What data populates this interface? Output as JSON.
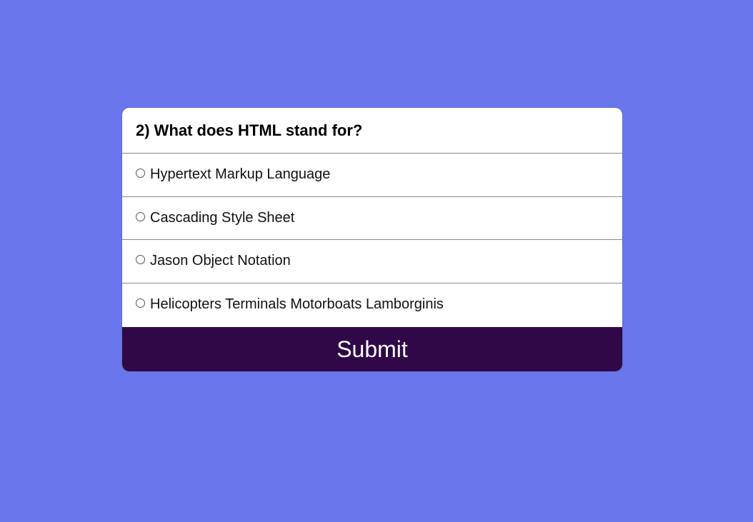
{
  "quiz": {
    "question": "2) What does HTML stand for?",
    "answers": [
      {
        "label": "Hypertext Markup Language"
      },
      {
        "label": "Cascading Style Sheet"
      },
      {
        "label": "Jason Object Notation"
      },
      {
        "label": "Helicopters Terminals Motorboats Lamborginis"
      }
    ],
    "submit_label": "Submit"
  },
  "colors": {
    "background": "#6a76ec",
    "card": "#ffffff",
    "submit_button": "#300847",
    "submit_text": "#ffffff"
  }
}
